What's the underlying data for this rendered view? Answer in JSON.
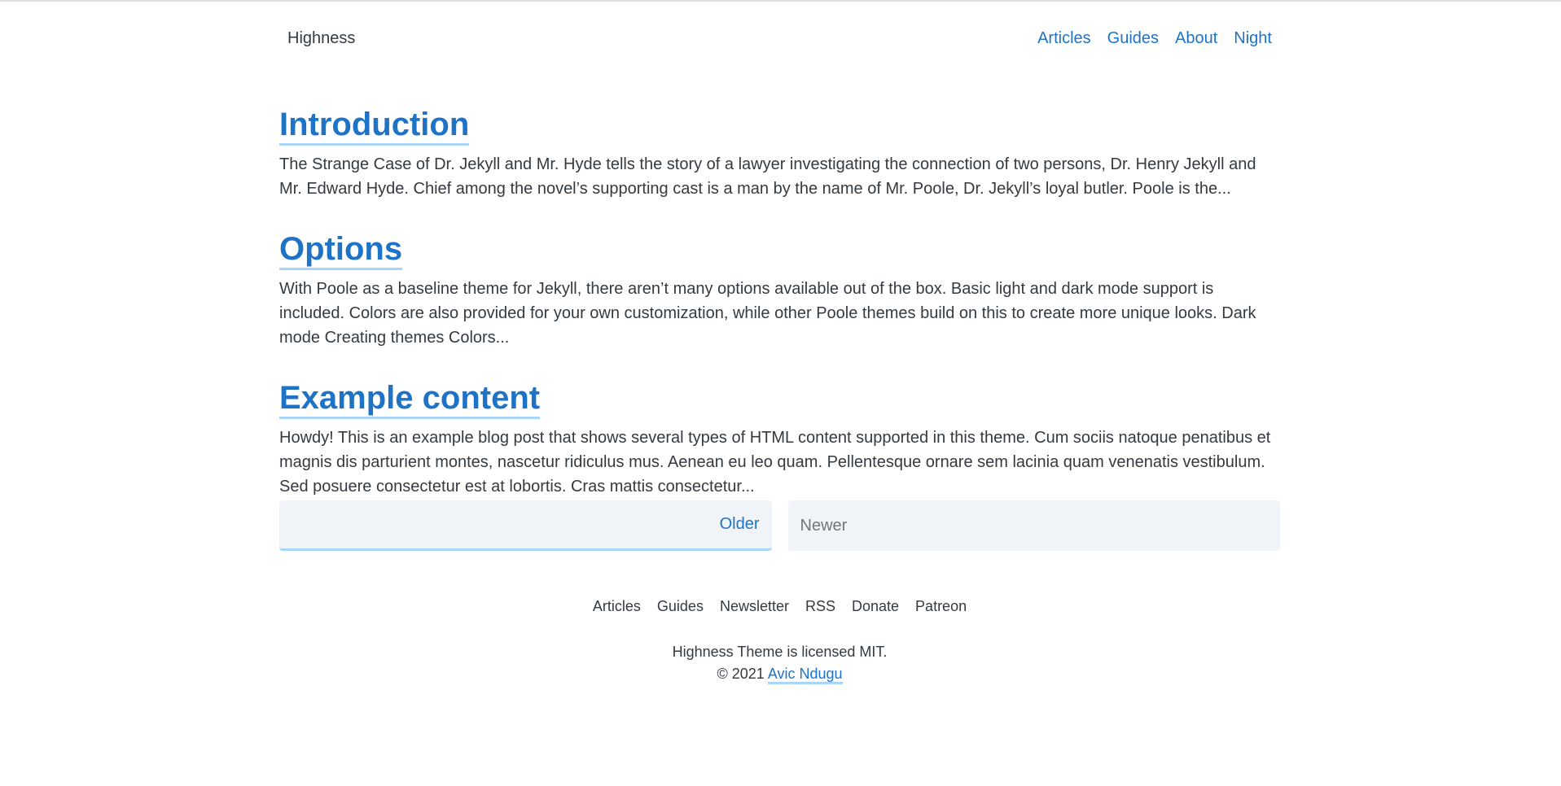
{
  "header": {
    "brand": "Highness",
    "nav": [
      "Articles",
      "Guides",
      "About",
      "Night"
    ]
  },
  "posts": [
    {
      "title": "Introduction",
      "excerpt": "The Strange Case of Dr. Jekyll and Mr. Hyde tells the story of a lawyer investigating the connection of two persons, Dr. Henry Jekyll and Mr. Edward Hyde. Chief among the novel’s supporting cast is a man by the name of Mr. Poole, Dr. Jekyll’s loyal butler. Poole is the..."
    },
    {
      "title": "Options",
      "excerpt": "With Poole as a baseline theme for Jekyll, there aren’t many options available out of the box. Basic light and dark mode support is included. Colors are also provided for your own customization, while other Poole themes build on this to create more unique looks. Dark mode Creating themes Colors..."
    },
    {
      "title": "Example content",
      "excerpt": "Howdy! This is an example blog post that shows several types of HTML content supported in this theme. Cum sociis natoque penatibus et magnis dis parturient montes, nascetur ridiculus mus. Aenean eu leo quam. Pellentesque ornare sem lacinia quam venenatis vestibulum. Sed posuere consectetur est at lobortis. Cras mattis consectetur..."
    }
  ],
  "pagination": {
    "older": "Older",
    "newer": "Newer"
  },
  "footer": {
    "nav": [
      "Articles",
      "Guides",
      "Newsletter",
      "RSS",
      "Donate",
      "Patreon"
    ],
    "license": "Highness Theme is licensed MIT.",
    "copyright": "© 2021",
    "author": "Avic Ndugu"
  },
  "colors": {
    "accent": "#1e73c6",
    "underline": "#a8d6fb",
    "text": "#333a40",
    "pager_bg": "#f0f3f8"
  }
}
